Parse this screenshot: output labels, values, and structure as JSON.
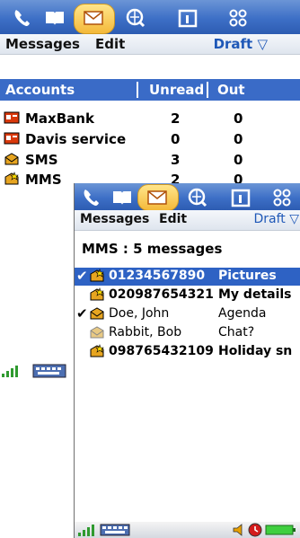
{
  "screen1": {
    "menu": {
      "messages": "Messages",
      "edit": "Edit",
      "draft": "Draft ▽"
    },
    "columns": {
      "accounts": "Accounts",
      "unread": "Unread",
      "out": "Out"
    },
    "accounts": [
      {
        "name": "MaxBank",
        "unread": "2",
        "out": "0",
        "icon": "email-account-icon"
      },
      {
        "name": "Davis service",
        "unread": "0",
        "out": "0",
        "icon": "email-account-icon"
      },
      {
        "name": "SMS",
        "unread": "3",
        "out": "0",
        "icon": "sms-icon"
      },
      {
        "name": "MMS",
        "unread": "2",
        "out": "0",
        "icon": "mms-icon"
      }
    ]
  },
  "screen2": {
    "menu": {
      "messages": "Messages",
      "edit": "Edit",
      "draft": "Draft ▽"
    },
    "summary": "MMS : 5 messages",
    "messages": [
      {
        "from": "01234567890",
        "subject": "Pictures",
        "checked": "✔",
        "bold": true,
        "selected": true
      },
      {
        "from": "020987654321",
        "subject": "My details",
        "checked": "",
        "bold": true,
        "selected": false
      },
      {
        "from": "Doe, John",
        "subject": "Agenda",
        "checked": "✔",
        "bold": false,
        "selected": false
      },
      {
        "from": "Rabbit, Bob",
        "subject": "Chat?",
        "checked": "",
        "bold": false,
        "selected": false
      },
      {
        "from": "098765432109",
        "subject": "Holiday sn",
        "checked": "",
        "bold": true,
        "selected": false
      }
    ]
  },
  "colors": {
    "titlebar": "#3d6fc6",
    "selection": "#2e62c4",
    "accent": "#1f58b7",
    "tab_highlight": "#f4b93a"
  }
}
